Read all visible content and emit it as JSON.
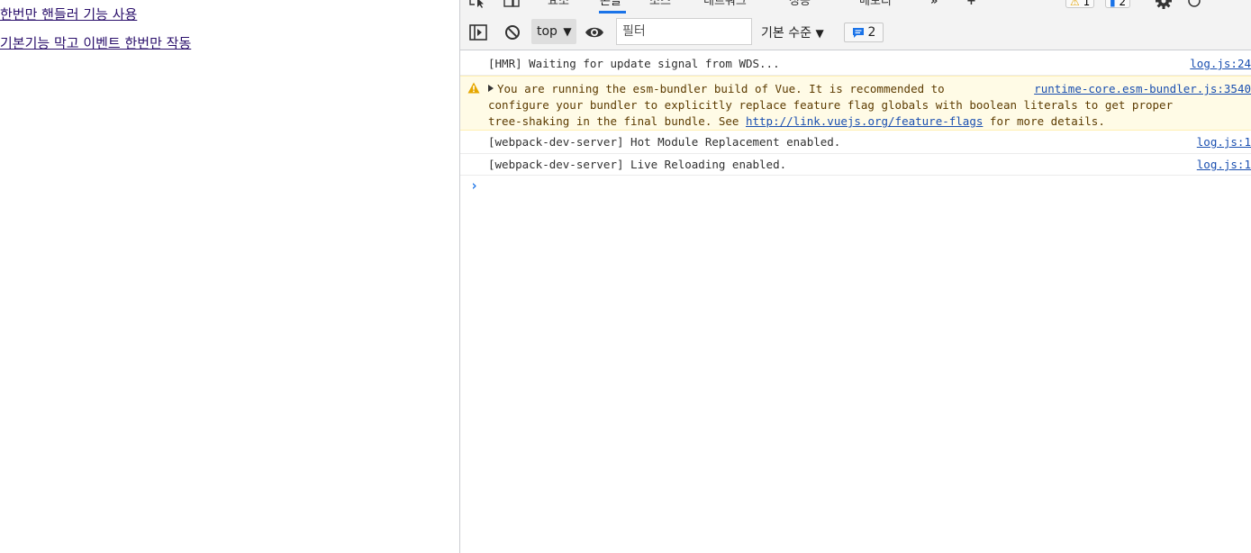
{
  "page": {
    "links": [
      "한번만 핸들러 기능 사용",
      "기본기능 막고 이벤트 한번만 작동"
    ]
  },
  "devtools": {
    "tabs": [
      {
        "label": "요소",
        "active": false
      },
      {
        "label": "콘솔",
        "active": true
      },
      {
        "label": "소스",
        "active": false
      },
      {
        "label": "네트워크",
        "active": false
      },
      {
        "label": "성능",
        "active": false
      },
      {
        "label": "메모리",
        "active": false
      }
    ],
    "more_tabs_label": "»",
    "warning_count": "1",
    "message_count": "2",
    "toolbar": {
      "context": "top",
      "filter_placeholder": "필터",
      "level": "기본 수준",
      "issues_count": "2"
    },
    "colors": {
      "accent": "#1a73e8",
      "warning_bg": "#fffbe6",
      "link": "#1a4fb0"
    },
    "messages": [
      {
        "type": "log",
        "text": "[HMR] Waiting for update signal from WDS...",
        "source": "log.js:24"
      },
      {
        "type": "warning",
        "line1": "You are running the esm-bundler build of Vue. It is recommended to",
        "line2": "configure your bundler to explicitly replace feature flag globals with boolean literals to get proper",
        "line3_pre": "tree-shaking in the final bundle. See ",
        "line3_link": "http://link.vuejs.org/feature-flags",
        "line3_post": " for more details.",
        "source": "runtime-core.esm-bundler.js:3540"
      },
      {
        "type": "log",
        "text": "[webpack-dev-server] Hot Module Replacement enabled.",
        "source": "log.js:1"
      },
      {
        "type": "log",
        "text": "[webpack-dev-server] Live Reloading enabled.",
        "source": "log.js:1"
      }
    ],
    "prompt": "›"
  }
}
